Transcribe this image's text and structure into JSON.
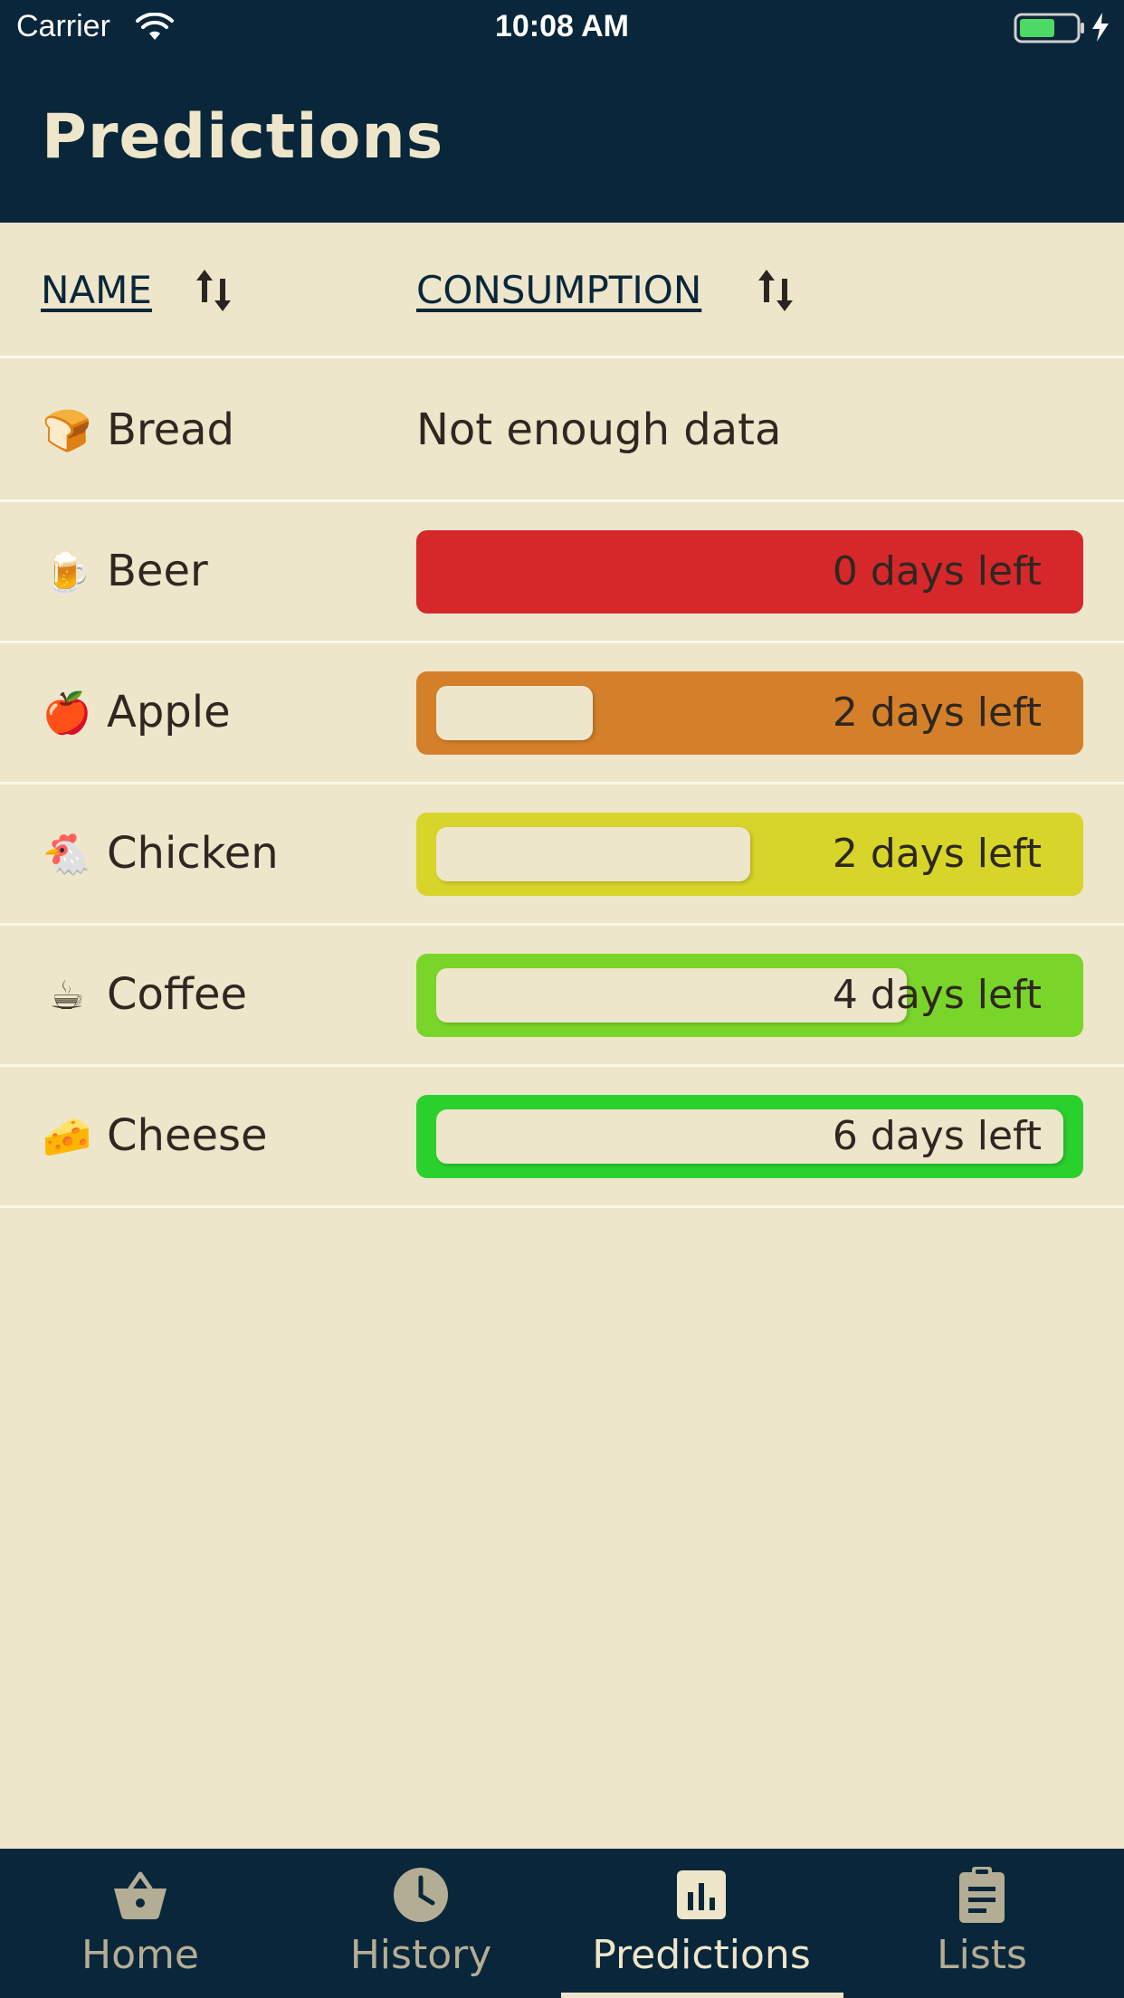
{
  "status_bar": {
    "carrier": "Carrier",
    "time": "10:08 AM",
    "battery_icon": "battery-charging-icon",
    "wifi_icon": "wifi-icon"
  },
  "header": {
    "title": "Predictions"
  },
  "columns": {
    "name_label": "NAME",
    "consumption_label": "CONSUMPTION",
    "sort_icon": "sort-arrows-icon"
  },
  "items": [
    {
      "emoji": "🍞",
      "icon": "bread-icon",
      "name": "Bread",
      "status": "Not enough data"
    },
    {
      "emoji": "🍺",
      "icon": "beer-icon",
      "name": "Beer",
      "label": "0 days left",
      "bar_color": "#d6282b",
      "level": 0.0
    },
    {
      "emoji": "🍎",
      "icon": "apple-icon",
      "name": "Apple",
      "label": "2 days left",
      "bar_color": "#d4802a",
      "level": 0.25
    },
    {
      "emoji": "🐔",
      "icon": "chicken-icon",
      "name": "Chicken",
      "label": "2 days left",
      "bar_color": "#d7d529",
      "level": 0.5
    },
    {
      "emoji": "☕",
      "icon": "coffee-icon",
      "name": "Coffee",
      "label": "4 days left",
      "bar_color": "#7ad52a",
      "level": 0.75
    },
    {
      "emoji": "🧀",
      "icon": "cheese-icon",
      "name": "Cheese",
      "label": "6 days left",
      "bar_color": "#2ad12d",
      "level": 1.0
    }
  ],
  "tabs": [
    {
      "label": "Home",
      "icon": "basket-icon",
      "active": false
    },
    {
      "label": "History",
      "icon": "clock-icon",
      "active": false
    },
    {
      "label": "Predictions",
      "icon": "bar-chart-icon",
      "active": true
    },
    {
      "label": "Lists",
      "icon": "clipboard-icon",
      "active": false
    }
  ],
  "colors": {
    "navy": "#0a263a",
    "background": "#ede6ca",
    "inactive_tab": "#b4ad95"
  }
}
